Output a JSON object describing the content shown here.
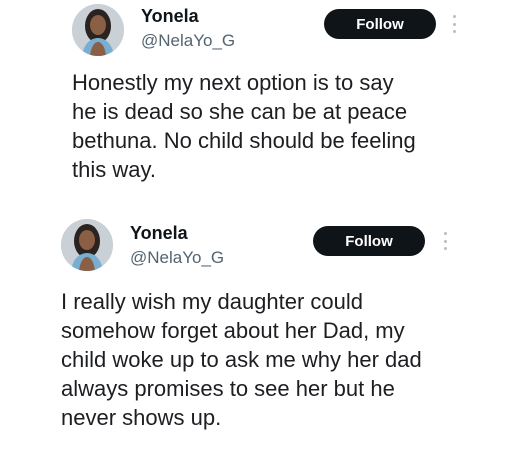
{
  "tweets": [
    {
      "name": "Yonela",
      "handle": "@NelaYo_G",
      "follow_label": "Follow",
      "text": "Honestly my next option is to say\nhe is dead so she can be at peace\nbethuna. No child should be feeling\nthis way."
    },
    {
      "name": "Yonela",
      "handle": "@NelaYo_G",
      "follow_label": "Follow",
      "text": "I really wish my daughter could\nsomehow forget about her Dad, my\nchild woke up to ask me why her dad\nalways promises to see her but he\nnever shows up."
    }
  ],
  "colors": {
    "follow_bg": "#0f1419",
    "follow_text": "#ffffff",
    "handle": "#536471",
    "text": "#1c1e21"
  },
  "icons": {
    "more": "more-vertical-icon"
  }
}
